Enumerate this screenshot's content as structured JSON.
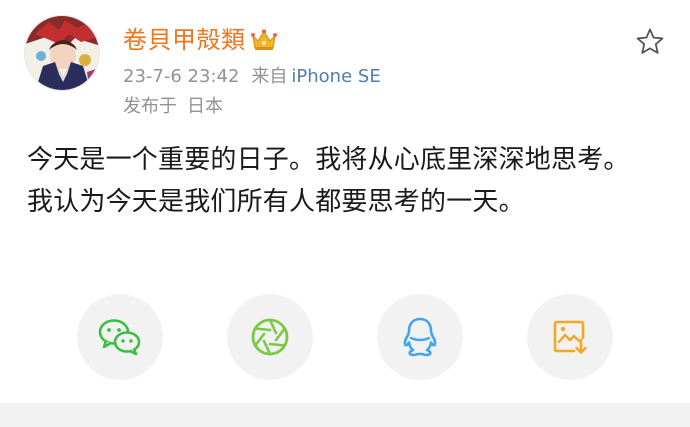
{
  "post": {
    "username": "卷貝甲殻類",
    "timestamp": "23-7-6 23:42",
    "source_prefix": "来自",
    "device": "iPhone SE",
    "location_prefix": "发布于",
    "location": "日本",
    "text": "今天是一个重要的日子。我将从心底里深深地思考。我认为今天是我们所有人都要思考的一天。"
  },
  "icons": {
    "favorite": "star-outline-icon",
    "verified": "crown-icon",
    "share_wechat": "wechat-icon",
    "share_moments": "moments-aperture-icon",
    "share_qq": "qq-penguin-icon",
    "share_save_image": "save-image-icon"
  },
  "colors": {
    "username": "#f0751f",
    "meta": "#929292",
    "device": "#507daf",
    "body_text": "#1a1a1a",
    "button_bg": "#f2f2f2",
    "wechat": "#3bbf3f",
    "moments": "#7ac943",
    "qq": "#3ea6f2",
    "save_image": "#f5a623"
  }
}
